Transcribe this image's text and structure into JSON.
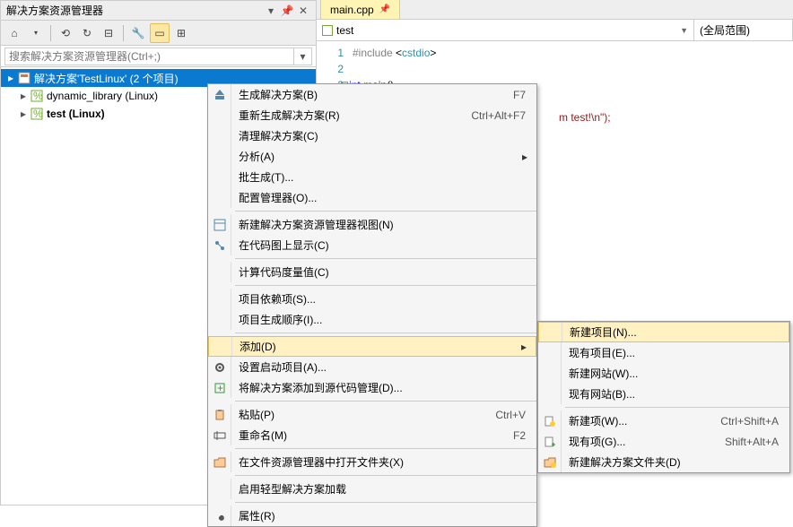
{
  "solution_explorer": {
    "title": "解决方案资源管理器",
    "search_placeholder": "搜索解决方案资源管理器(Ctrl+;)",
    "root": "解决方案'TestLinux' (2 个项目)",
    "items": [
      {
        "label": "dynamic_library (Linux)",
        "bold": false
      },
      {
        "label": "test (Linux)",
        "bold": true
      }
    ]
  },
  "editor": {
    "tab": "main.cpp",
    "crumb_left": "test",
    "crumb_right": "(全局范围)",
    "lines": {
      "l1_num": "1",
      "l1": [
        "#include",
        " <",
        "cstdio",
        ">"
      ],
      "l2_num": "2",
      "l3_num": "3",
      "l3_a": "int",
      "l3_b": " main()",
      "l5": "m test!\\n\");"
    }
  },
  "menu1": {
    "items": [
      {
        "icon": "build",
        "label": "生成解决方案(B)",
        "shortcut": "F7"
      },
      {
        "icon": "",
        "label": "重新生成解决方案(R)",
        "shortcut": "Ctrl+Alt+F7"
      },
      {
        "icon": "",
        "label": "清理解决方案(C)",
        "shortcut": ""
      },
      {
        "icon": "",
        "label": "分析(A)",
        "shortcut": "",
        "arrow": true
      },
      {
        "icon": "",
        "label": "批生成(T)...",
        "shortcut": ""
      },
      {
        "icon": "",
        "label": "配置管理器(O)...",
        "shortcut": ""
      },
      {
        "sep": true
      },
      {
        "icon": "view",
        "label": "新建解决方案资源管理器视图(N)",
        "shortcut": ""
      },
      {
        "icon": "codemap",
        "label": "在代码图上显示(C)",
        "shortcut": ""
      },
      {
        "sep": true
      },
      {
        "icon": "",
        "label": "计算代码度量值(C)",
        "shortcut": ""
      },
      {
        "sep": true
      },
      {
        "icon": "",
        "label": "项目依赖项(S)...",
        "shortcut": ""
      },
      {
        "icon": "",
        "label": "项目生成顺序(I)...",
        "shortcut": ""
      },
      {
        "sep": true
      },
      {
        "icon": "",
        "label": "添加(D)",
        "shortcut": "",
        "arrow": true,
        "highlight": true
      },
      {
        "icon": "gear",
        "label": "设置启动项目(A)...",
        "shortcut": ""
      },
      {
        "icon": "scc",
        "label": "将解决方案添加到源代码管理(D)...",
        "shortcut": ""
      },
      {
        "sep": true
      },
      {
        "icon": "paste",
        "label": "粘贴(P)",
        "shortcut": "Ctrl+V"
      },
      {
        "icon": "rename",
        "label": "重命名(M)",
        "shortcut": "F2"
      },
      {
        "sep": true
      },
      {
        "icon": "folder",
        "label": "在文件资源管理器中打开文件夹(X)",
        "shortcut": ""
      },
      {
        "sep": true
      },
      {
        "icon": "",
        "label": "启用轻型解决方案加载",
        "shortcut": ""
      },
      {
        "sep": true
      },
      {
        "icon": "wrench",
        "label": "属性(R)",
        "shortcut": ""
      }
    ]
  },
  "menu2": {
    "items": [
      {
        "icon": "",
        "label": "新建项目(N)...",
        "shortcut": "",
        "highlight": true,
        "redbox": true
      },
      {
        "icon": "",
        "label": "现有项目(E)...",
        "shortcut": ""
      },
      {
        "icon": "",
        "label": "新建网站(W)...",
        "shortcut": ""
      },
      {
        "icon": "",
        "label": "现有网站(B)...",
        "shortcut": ""
      },
      {
        "sep": true
      },
      {
        "icon": "newitem",
        "label": "新建项(W)...",
        "shortcut": "Ctrl+Shift+A"
      },
      {
        "icon": "existitem",
        "label": "现有项(G)...",
        "shortcut": "Shift+Alt+A"
      },
      {
        "icon": "newfolder",
        "label": "新建解决方案文件夹(D)",
        "shortcut": ""
      }
    ]
  }
}
